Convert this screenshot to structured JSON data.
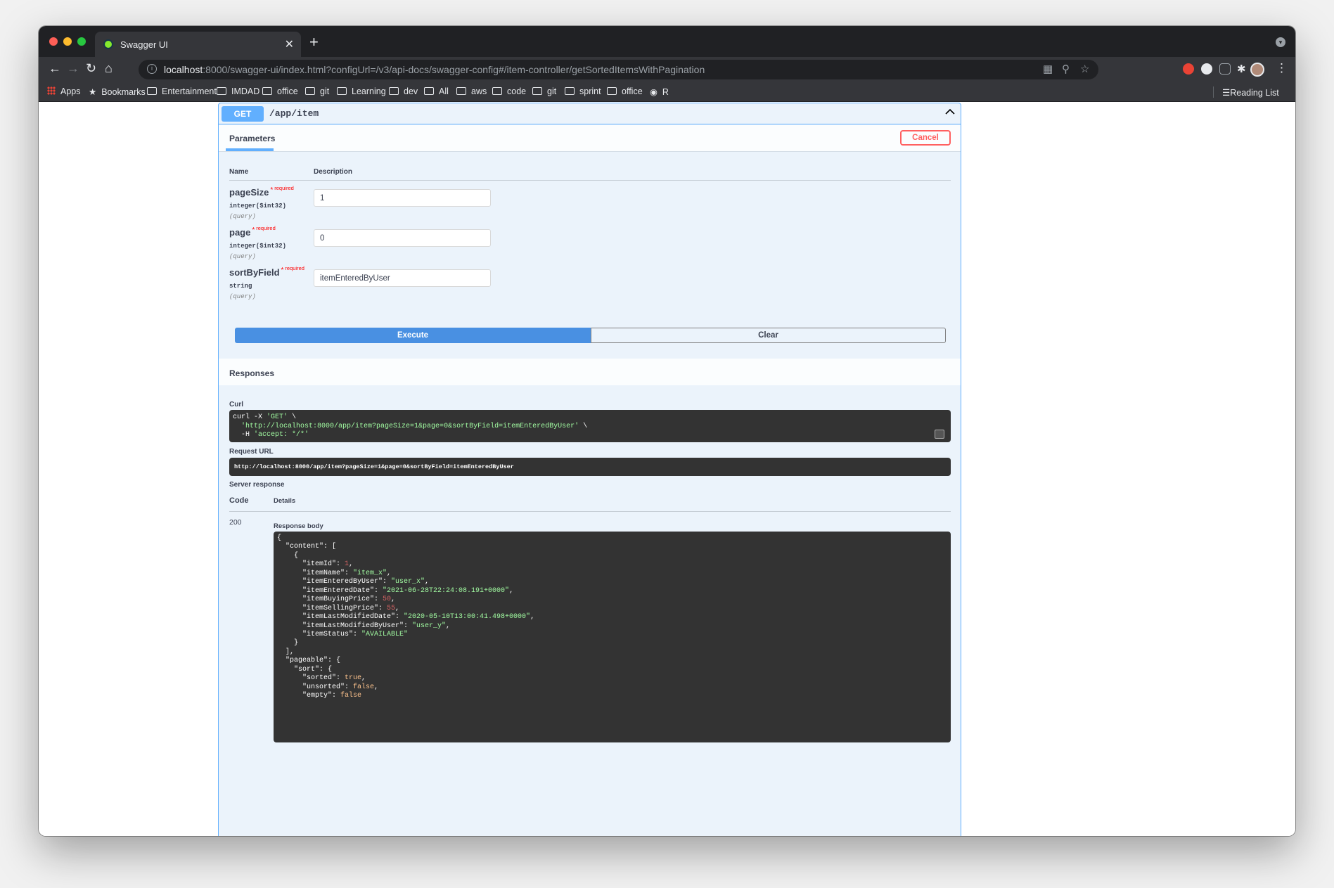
{
  "browser": {
    "tab_title": "Swagger UI",
    "url_host": "localhost",
    "url_rest": ":8000/swagger-ui/index.html?configUrl=/v3/api-docs/swagger-config#/item-controller/getSortedItemsWithPagination",
    "bookmarks": [
      "Apps",
      "Bookmarks",
      "Entertainment",
      "IMDAD",
      "office",
      "git",
      "Learning",
      "dev",
      "All",
      "aws",
      "code",
      "git",
      "sprint",
      "office",
      "R"
    ],
    "reading_list": "Reading List"
  },
  "operation": {
    "method": "GET",
    "path": "/app/item",
    "parameters_tab": "Parameters",
    "cancel_label": "Cancel",
    "col_name": "Name",
    "col_description": "Description",
    "params": [
      {
        "name": "pageSize",
        "required": "required",
        "type": "integer($int32)",
        "in": "(query)",
        "value": "1"
      },
      {
        "name": "page",
        "required": "required",
        "type": "integer($int32)",
        "in": "(query)",
        "value": "0"
      },
      {
        "name": "sortByField",
        "required": "required",
        "type": "string",
        "in": "(query)",
        "value": "itemEnteredByUser"
      }
    ],
    "execute_label": "Execute",
    "clear_label": "Clear"
  },
  "responses": {
    "title": "Responses",
    "curl_label": "Curl",
    "curl_lines": [
      {
        "plain": "curl -X ",
        "str": "'GET'",
        "tail": " \\"
      },
      {
        "plain": "  ",
        "str": "'http://localhost:8000/app/item?pageSize=1&page=0&sortByField=itemEnteredByUser'",
        "tail": " \\"
      },
      {
        "plain": "  -H ",
        "str": "'accept: */*'",
        "tail": ""
      }
    ],
    "request_url_label": "Request URL",
    "request_url": "http://localhost:8000/app/item?pageSize=1&page=0&sortByField=itemEnteredByUser",
    "server_response_label": "Server response",
    "code_header": "Code",
    "details_header": "Details",
    "code": "200",
    "response_body_label": "Response body",
    "body_lines": [
      {
        "t": "{"
      },
      {
        "t": "  \"content\": ["
      },
      {
        "t": "    {"
      },
      {
        "k": "      \"itemId\": ",
        "v": "1",
        "c": "num",
        "e": ","
      },
      {
        "k": "      \"itemName\": ",
        "v": "\"item_x\"",
        "c": "str",
        "e": ","
      },
      {
        "k": "      \"itemEnteredByUser\": ",
        "v": "\"user_x\"",
        "c": "str",
        "e": ","
      },
      {
        "k": "      \"itemEnteredDate\": ",
        "v": "\"2021-06-28T22:24:08.191+0000\"",
        "c": "str",
        "e": ","
      },
      {
        "k": "      \"itemBuyingPrice\": ",
        "v": "50",
        "c": "num",
        "e": ","
      },
      {
        "k": "      \"itemSellingPrice\": ",
        "v": "55",
        "c": "num",
        "e": ","
      },
      {
        "k": "      \"itemLastModifiedDate\": ",
        "v": "\"2020-05-10T13:00:41.498+0000\"",
        "c": "str",
        "e": ","
      },
      {
        "k": "      \"itemLastModifiedByUser\": ",
        "v": "\"user_y\"",
        "c": "str",
        "e": ","
      },
      {
        "k": "      \"itemStatus\": ",
        "v": "\"AVAILABLE\"",
        "c": "str",
        "e": ""
      },
      {
        "t": "    }"
      },
      {
        "t": "  ],"
      },
      {
        "t": "  \"pageable\": {"
      },
      {
        "t": "    \"sort\": {"
      },
      {
        "k": "      \"sorted\": ",
        "v": "true",
        "c": "bool",
        "e": ","
      },
      {
        "k": "      \"unsorted\": ",
        "v": "false",
        "c": "bool",
        "e": ","
      },
      {
        "k": "      \"empty\": ",
        "v": "false",
        "c": "bool",
        "e": ""
      }
    ]
  },
  "colors": {
    "get_blue": "#61affe",
    "execute_blue": "#4990e2",
    "cancel_red": "#ff6060",
    "code_bg": "#333333"
  }
}
